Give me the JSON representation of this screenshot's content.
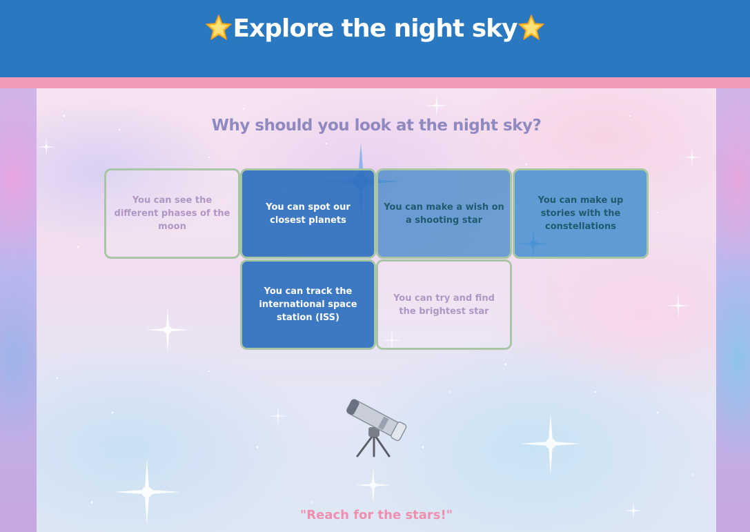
{
  "header": {
    "title": "Explore the night sky",
    "icon_left": "star-emoji",
    "icon_right": "star-emoji"
  },
  "section": {
    "title": "Why should you look at the night sky?"
  },
  "cards": [
    {
      "text": "You can see the different phases of the moon",
      "style": "light"
    },
    {
      "text": "You can spot our closest planets",
      "style": "dark"
    },
    {
      "text": "You can make a wish on a shooting star",
      "style": "mid"
    },
    {
      "text": "You can make up stories with the constellations",
      "style": "midlight"
    },
    {
      "text": "You can track the international space station (ISS)",
      "style": "dark"
    },
    {
      "text": "You can try and find the brightest star",
      "style": "light"
    }
  ],
  "telescope": {
    "icon": "telescope-icon"
  },
  "quote": {
    "text": "\"Reach for the stars!\""
  },
  "colors": {
    "header_bg": "#2a78bf",
    "pink_strip": "#ef9bb9",
    "section_title": "#8f89bf",
    "card_border": "#a8c6a6",
    "card_dark": "#2e70be",
    "quote": "#ef8fb0"
  }
}
